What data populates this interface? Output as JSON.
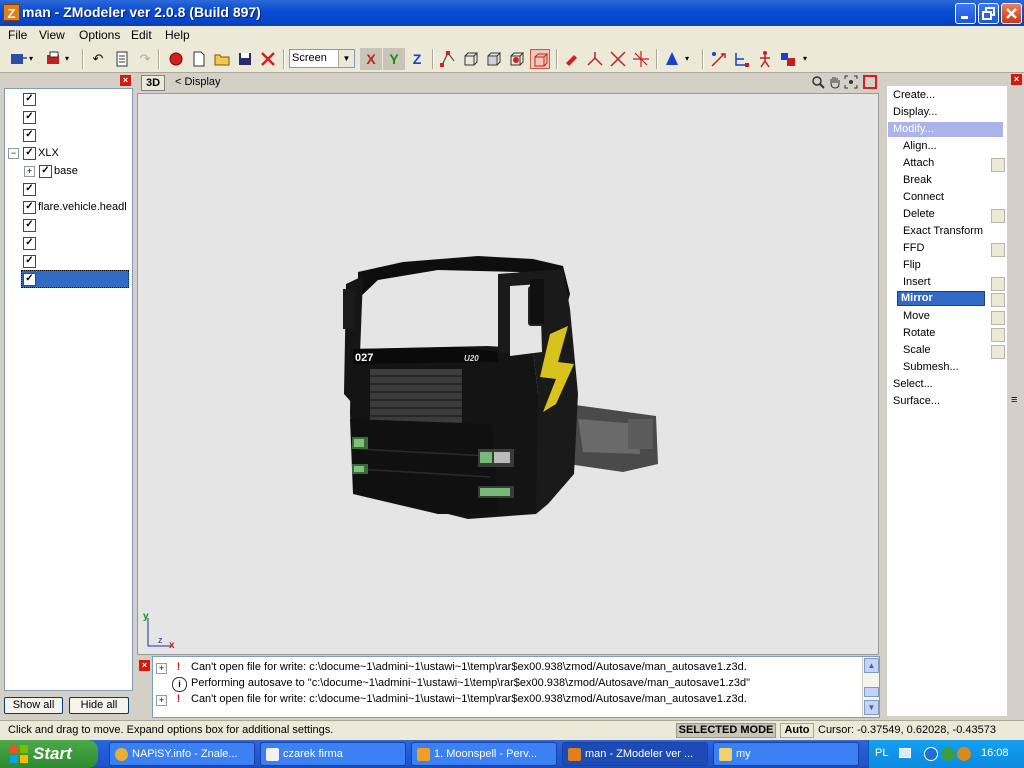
{
  "window": {
    "title": "man - ZModeler ver 2.0.8 (Build 897)",
    "app_icon": "Z"
  },
  "menu": [
    {
      "label": "File"
    },
    {
      "label": "View"
    },
    {
      "label": "Options"
    },
    {
      "label": "Edit"
    },
    {
      "label": "Help"
    }
  ],
  "toolbar": {
    "coord_mode": "Screen",
    "axis_x": "X",
    "axis_y": "Y",
    "axis_z": "Z"
  },
  "tree": {
    "rows": [
      {
        "checked": true,
        "label": ""
      },
      {
        "checked": true,
        "label": ""
      },
      {
        "checked": true,
        "label": ""
      },
      {
        "checked": true,
        "label": "XLX",
        "expander": "−"
      },
      {
        "checked": true,
        "label": "base",
        "expander": "+"
      },
      {
        "checked": true,
        "label": ""
      },
      {
        "checked": true,
        "label": "flare.vehicle.headl"
      },
      {
        "checked": true,
        "label": ""
      },
      {
        "checked": true,
        "label": ""
      },
      {
        "checked": true,
        "label": ""
      },
      {
        "checked": true,
        "label": "",
        "selected": true
      }
    ],
    "show_all": "Show all",
    "hide_all": "Hide all"
  },
  "viewport": {
    "mode_label": "3D",
    "view_name": "< Display",
    "axis_y": "y",
    "axis_z": "z",
    "axis_x": "x",
    "model_decal_number": "027",
    "model_decal_text": "U20"
  },
  "commands": [
    {
      "label": "Create...",
      "level": 0
    },
    {
      "label": "Display...",
      "level": 0
    },
    {
      "label": "Modify...",
      "level": 0,
      "highlight": true
    },
    {
      "label": "Align...",
      "level": 1
    },
    {
      "label": "Attach",
      "level": 1,
      "option": true
    },
    {
      "label": "Break",
      "level": 1
    },
    {
      "label": "Connect",
      "level": 1
    },
    {
      "label": "Delete",
      "level": 1,
      "option": true
    },
    {
      "label": "Exact Transform",
      "level": 1
    },
    {
      "label": "FFD",
      "level": 1,
      "option": true
    },
    {
      "label": "Flip",
      "level": 1
    },
    {
      "label": "Insert",
      "level": 1,
      "option": true
    },
    {
      "label": "Mirror",
      "level": 1,
      "option": true,
      "active": true
    },
    {
      "label": "Move",
      "level": 1,
      "option": true
    },
    {
      "label": "Rotate",
      "level": 1,
      "option": true
    },
    {
      "label": "Scale",
      "level": 1,
      "option": true
    },
    {
      "label": "Submesh...",
      "level": 1
    },
    {
      "label": "Select...",
      "level": 0
    },
    {
      "label": "Surface...",
      "level": 0
    }
  ],
  "log": [
    {
      "type": "error",
      "text": "Can't open file for write: c:\\docume~1\\admini~1\\ustawi~1\\temp\\rar$ex00.938\\zmod/Autosave/man_autosave1.z3d."
    },
    {
      "type": "info",
      "text": "Performing autosave to \"c:\\docume~1\\admini~1\\ustawi~1\\temp\\rar$ex00.938\\zmod/Autosave/man_autosave1.z3d\""
    },
    {
      "type": "error",
      "text": "Can't open file for write: c:\\docume~1\\admini~1\\ustawi~1\\temp\\rar$ex00.938\\zmod/Autosave/man_autosave1.z3d."
    }
  ],
  "status": {
    "hint": "Click and drag to move. Expand options box for additional settings.",
    "mode": "SELECTED MODE",
    "auto": "Auto",
    "cursor": "Cursor: -0.37549, 0.62028, -0.43573"
  },
  "taskbar": {
    "start": "Start",
    "tasks": [
      {
        "label": "NAPiSY.info - Znale...",
        "color": "#e8b030"
      },
      {
        "label": "czarek firma",
        "color": "#f2f2f2"
      },
      {
        "label": "1. Moonspell - Perv...",
        "color": "#f0a020"
      },
      {
        "label": "man - ZModeler ver ...",
        "color": "#e0801a",
        "active": true
      },
      {
        "label": "my",
        "color": "#f4d068"
      }
    ],
    "lang": "PL",
    "clock": "16:08"
  }
}
